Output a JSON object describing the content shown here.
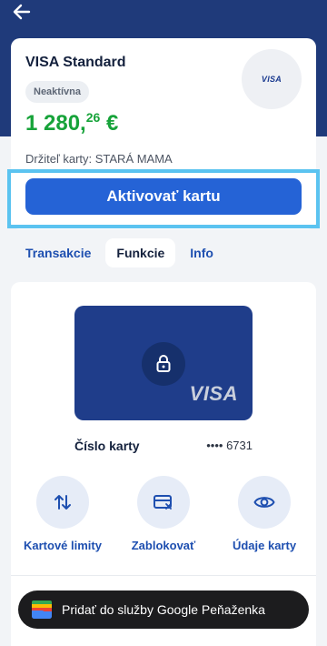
{
  "card": {
    "name": "VISA Standard",
    "status": "Neaktívna",
    "balance_main": "1 280,",
    "balance_cents": "26",
    "currency": "€",
    "brand_logo": "VISA",
    "holder": "Držiteľ karty: STARÁ MAMA",
    "activate_label": "Aktivovať kartu"
  },
  "tabs": [
    {
      "label": "Transakcie",
      "active": false
    },
    {
      "label": "Funkcie",
      "active": true
    },
    {
      "label": "Info",
      "active": false
    }
  ],
  "features": {
    "card_logo": "VISA",
    "card_number_label": "Číslo karty",
    "card_number_value": "•••• 6731",
    "actions": [
      {
        "label": "Kartové limity",
        "icon": "swap-vertical-icon"
      },
      {
        "label": "Zablokovať",
        "icon": "card-block-icon"
      },
      {
        "label": "Údaje karty",
        "icon": "eye-icon"
      }
    ]
  },
  "google_wallet": {
    "label": "Pridať do služby Google Peňaženka",
    "icon": "google-wallet-icon"
  },
  "colors": {
    "header": "#1f3a7a",
    "primary": "#2563d6",
    "balance": "#17a33a",
    "link": "#1e4fb0",
    "highlight": "#5bc3f0"
  }
}
